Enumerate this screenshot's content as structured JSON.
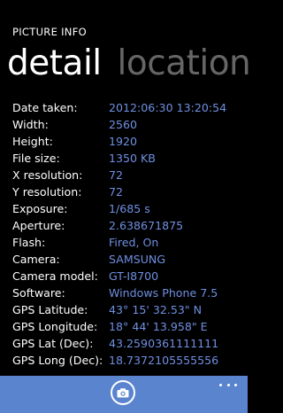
{
  "app_title": "PICTURE INFO",
  "pivot": {
    "tabs": [
      {
        "label": "detail",
        "active": true
      },
      {
        "label": "location",
        "active": false
      }
    ]
  },
  "details": [
    {
      "label": "Date taken:",
      "value": "2012:06:30 13:20:54"
    },
    {
      "label": "Width:",
      "value": "2560"
    },
    {
      "label": "Height:",
      "value": "1920"
    },
    {
      "label": "File size:",
      "value": "1350 KB"
    },
    {
      "label": "X resolution:",
      "value": "72"
    },
    {
      "label": "Y resolution:",
      "value": "72"
    },
    {
      "label": "Exposure:",
      "value": "1/685 s"
    },
    {
      "label": "Aperture:",
      "value": "2.638671875"
    },
    {
      "label": "Flash:",
      "value": "Fired, On"
    },
    {
      "label": "Camera:",
      "value": "SAMSUNG"
    },
    {
      "label": "Camera model:",
      "value": "GT-I8700"
    },
    {
      "label": "Software:",
      "value": "Windows Phone 7.5"
    },
    {
      "label": "GPS Latitude:",
      "value": "43° 15' 32.53\" N"
    },
    {
      "label": "GPS Longitude:",
      "value": "18° 44' 13.958\" E"
    },
    {
      "label": "GPS Lat (Dec):",
      "value": "43.2590361111111"
    },
    {
      "label": "GPS Long (Dec):",
      "value": "18.7372105555556"
    }
  ],
  "app_bar": {
    "camera_icon": "camera-icon",
    "more_icon": "ellipsis-icon",
    "color": "#5b84cf"
  },
  "colors": {
    "background": "#000000",
    "value_text": "#6f8fe0",
    "inactive_tab": "#666666"
  }
}
